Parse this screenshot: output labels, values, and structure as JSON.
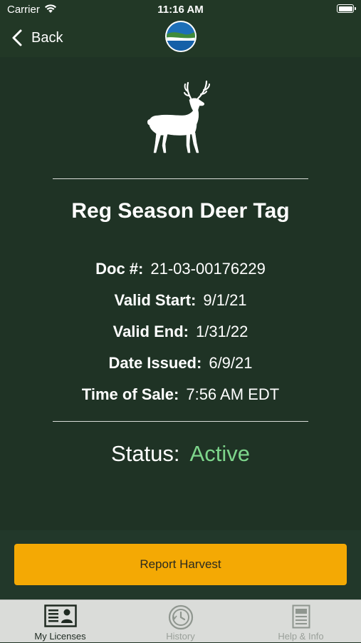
{
  "status_bar": {
    "carrier": "Carrier",
    "time": "11:16 AM"
  },
  "nav": {
    "back_label": "Back",
    "icons": [
      "chevron-left-icon",
      "agency-logo-icon"
    ]
  },
  "license": {
    "title": "Reg Season Deer Tag",
    "icon": "deer-icon",
    "details": [
      {
        "label": "Doc #:",
        "value": "21-03-00176229"
      },
      {
        "label": "Valid Start:",
        "value": "9/1/21"
      },
      {
        "label": "Valid End:",
        "value": "1/31/22"
      },
      {
        "label": "Date Issued:",
        "value": "6/9/21"
      },
      {
        "label": "Time of Sale:",
        "value": "7:56 AM EDT"
      }
    ],
    "status_label": "Status:",
    "status_value": "Active"
  },
  "actions": {
    "report_harvest_label": "Report Harvest"
  },
  "tabs": [
    {
      "label": "My Licenses",
      "icon": "license-card-icon",
      "active": true
    },
    {
      "label": "History",
      "icon": "history-clock-icon",
      "active": false
    },
    {
      "label": "Help & Info",
      "icon": "document-icon",
      "active": false
    }
  ],
  "colors": {
    "background": "#1f3325",
    "nav_background": "#223826",
    "status_active": "#7dd58b",
    "button_accent": "#f4a904",
    "tab_bar": "#dadcd9"
  }
}
